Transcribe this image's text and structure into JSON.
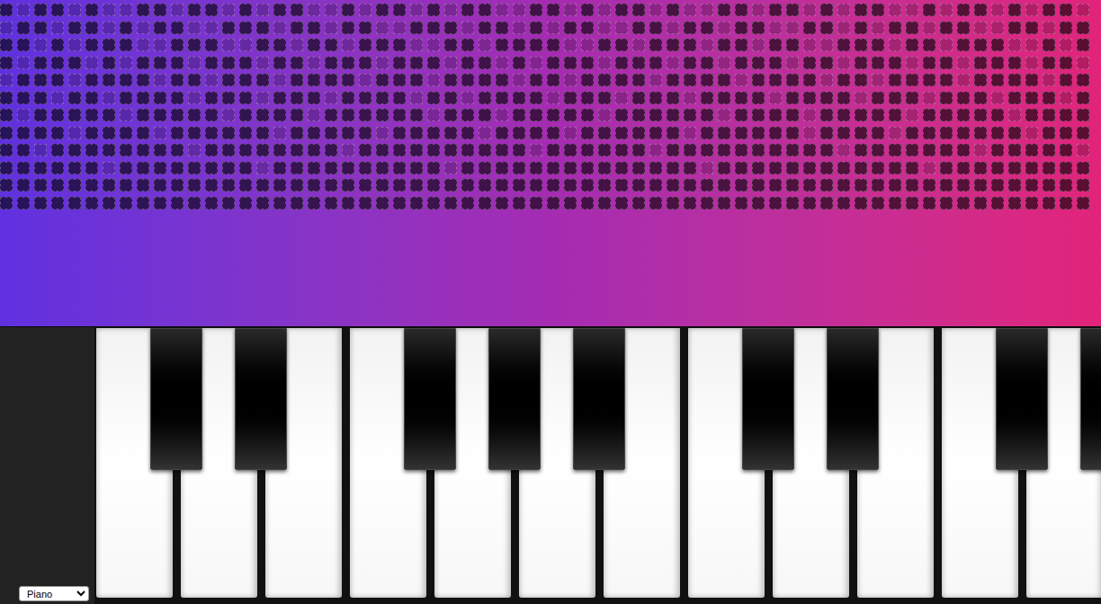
{
  "visualizer": {
    "rows": [
      [
        0,
        1,
        0,
        0,
        1,
        0,
        1,
        1,
        0,
        0,
        1,
        0,
        0,
        1,
        0,
        1,
        0,
        0,
        1,
        1,
        0,
        1,
        0,
        0,
        1,
        0,
        1,
        0,
        0,
        1,
        1,
        0,
        0,
        1,
        0,
        1,
        0,
        0,
        1,
        0,
        1,
        1,
        0,
        0,
        1,
        0,
        0,
        1,
        0,
        1,
        0,
        0,
        1,
        1,
        0,
        1,
        0,
        0,
        1,
        0,
        1,
        0,
        0,
        1
      ],
      [
        1,
        0,
        0,
        1,
        0,
        0,
        1,
        0,
        1,
        0,
        0,
        1,
        1,
        0,
        0,
        0,
        1,
        0,
        0,
        1,
        0,
        0,
        1,
        1,
        0,
        0,
        0,
        1,
        0,
        0,
        1,
        0,
        1,
        0,
        0,
        1,
        1,
        0,
        0,
        1,
        0,
        0,
        1,
        0,
        0,
        1,
        1,
        0,
        0,
        1,
        0,
        1,
        0,
        0,
        1,
        0,
        0,
        1,
        1,
        0,
        0,
        1,
        0,
        0
      ],
      [
        0,
        0,
        1,
        0,
        1,
        0,
        0,
        0,
        1,
        1,
        0,
        0,
        0,
        1,
        1,
        0,
        0,
        1,
        0,
        0,
        1,
        0,
        0,
        0,
        1,
        1,
        0,
        0,
        1,
        0,
        0,
        0,
        0,
        1,
        1,
        0,
        0,
        1,
        0,
        0,
        0,
        1,
        0,
        0,
        1,
        0,
        0,
        1,
        1,
        0,
        0,
        0,
        1,
        0,
        0,
        1,
        0,
        0,
        0,
        1,
        1,
        0,
        1,
        0
      ],
      [
        0,
        1,
        0,
        0,
        0,
        1,
        0,
        1,
        0,
        0,
        0,
        1,
        0,
        0,
        0,
        1,
        0,
        0,
        1,
        0,
        0,
        0,
        1,
        0,
        0,
        0,
        1,
        0,
        0,
        1,
        0,
        1,
        0,
        0,
        0,
        1,
        0,
        0,
        0,
        1,
        0,
        0,
        1,
        0,
        0,
        0,
        1,
        0,
        0,
        1,
        0,
        0,
        0,
        1,
        0,
        0,
        1,
        0,
        0,
        0,
        1,
        0,
        0,
        1
      ],
      [
        1,
        0,
        0,
        0,
        1,
        0,
        0,
        0,
        0,
        1,
        0,
        0,
        1,
        0,
        0,
        0,
        1,
        0,
        0,
        0,
        0,
        1,
        0,
        0,
        0,
        1,
        0,
        0,
        0,
        0,
        1,
        0,
        0,
        1,
        0,
        0,
        0,
        0,
        1,
        0,
        0,
        0,
        0,
        1,
        0,
        0,
        0,
        0,
        1,
        0,
        0,
        1,
        0,
        0,
        0,
        0,
        1,
        0,
        0,
        0,
        0,
        1,
        0,
        0
      ],
      [
        0,
        0,
        0,
        1,
        0,
        0,
        1,
        0,
        0,
        0,
        0,
        1,
        0,
        0,
        0,
        1,
        0,
        0,
        0,
        1,
        0,
        0,
        0,
        0,
        1,
        0,
        0,
        1,
        0,
        0,
        0,
        0,
        1,
        0,
        0,
        0,
        1,
        0,
        0,
        0,
        1,
        0,
        0,
        0,
        0,
        1,
        0,
        0,
        0,
        0,
        1,
        0,
        0,
        0,
        1,
        0,
        0,
        0,
        1,
        0,
        0,
        0,
        1,
        0
      ],
      [
        0,
        1,
        0,
        0,
        0,
        0,
        0,
        1,
        0,
        0,
        0,
        0,
        0,
        1,
        0,
        0,
        0,
        0,
        1,
        0,
        0,
        0,
        0,
        0,
        0,
        1,
        0,
        0,
        0,
        1,
        0,
        0,
        0,
        0,
        0,
        1,
        0,
        0,
        0,
        0,
        0,
        0,
        1,
        0,
        0,
        0,
        0,
        1,
        0,
        0,
        0,
        0,
        0,
        1,
        0,
        0,
        0,
        0,
        0,
        1,
        0,
        0,
        0,
        0
      ],
      [
        0,
        0,
        0,
        0,
        1,
        0,
        0,
        0,
        0,
        1,
        0,
        0,
        0,
        0,
        0,
        0,
        1,
        0,
        0,
        0,
        0,
        0,
        1,
        0,
        0,
        0,
        0,
        0,
        1,
        0,
        0,
        0,
        0,
        1,
        0,
        0,
        0,
        0,
        0,
        0,
        1,
        0,
        0,
        0,
        0,
        0,
        0,
        1,
        0,
        0,
        0,
        0,
        1,
        0,
        0,
        0,
        0,
        0,
        0,
        0,
        1,
        0,
        0,
        0
      ],
      [
        0,
        0,
        1,
        0,
        0,
        0,
        0,
        0,
        0,
        0,
        0,
        1,
        0,
        0,
        0,
        0,
        0,
        0,
        0,
        0,
        1,
        0,
        0,
        0,
        0,
        0,
        0,
        0,
        0,
        0,
        0,
        1,
        0,
        0,
        0,
        0,
        0,
        0,
        1,
        0,
        0,
        0,
        0,
        0,
        0,
        0,
        0,
        0,
        0,
        1,
        0,
        0,
        0,
        0,
        0,
        0,
        0,
        1,
        0,
        0,
        0,
        0,
        0,
        1
      ],
      [
        0,
        0,
        0,
        0,
        0,
        0,
        1,
        0,
        0,
        0,
        0,
        0,
        0,
        0,
        0,
        1,
        0,
        0,
        0,
        0,
        0,
        0,
        0,
        0,
        0,
        0,
        1,
        0,
        0,
        0,
        0,
        0,
        0,
        0,
        0,
        0,
        0,
        0,
        0,
        0,
        0,
        1,
        0,
        0,
        0,
        0,
        0,
        0,
        0,
        0,
        0,
        0,
        0,
        0,
        1,
        0,
        0,
        0,
        0,
        0,
        0,
        0,
        0,
        0
      ],
      [
        0,
        0,
        0,
        0,
        0,
        0,
        0,
        0,
        0,
        0,
        0,
        0,
        0,
        0,
        0,
        0,
        0,
        0,
        0,
        0,
        0,
        0,
        0,
        0,
        0,
        0,
        0,
        0,
        0,
        0,
        0,
        0,
        0,
        0,
        0,
        0,
        0,
        0,
        0,
        0,
        0,
        0,
        0,
        0,
        0,
        0,
        0,
        0,
        0,
        0,
        0,
        0,
        0,
        0,
        0,
        0,
        0,
        0,
        0,
        0,
        0,
        0,
        0,
        0
      ],
      [
        0,
        0,
        0,
        0,
        0,
        0,
        0,
        0,
        0,
        0,
        0,
        0,
        0,
        0,
        0,
        0,
        0,
        0,
        0,
        0,
        0,
        0,
        0,
        0,
        0,
        0,
        0,
        0,
        0,
        0,
        0,
        0,
        0,
        0,
        0,
        0,
        0,
        0,
        0,
        0,
        0,
        0,
        0,
        0,
        0,
        0,
        0,
        0,
        0,
        0,
        0,
        0,
        0,
        0,
        0,
        0,
        0,
        0,
        0,
        0,
        0,
        0,
        0,
        0
      ]
    ]
  },
  "keys": [
    {
      "sharp": true
    },
    {
      "sharp": true
    },
    {
      "sharp": false
    },
    {
      "sharp": true
    },
    {
      "sharp": true
    },
    {
      "sharp": true
    },
    {
      "sharp": false
    },
    {
      "sharp": true
    },
    {
      "sharp": true
    },
    {
      "sharp": false
    },
    {
      "sharp": true
    },
    {
      "sharp": true
    }
  ],
  "instrument": {
    "value": "Piano"
  }
}
